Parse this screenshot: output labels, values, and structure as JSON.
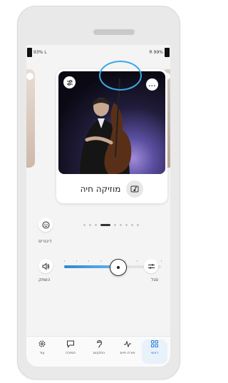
{
  "status_bar": {
    "left_text": "93% L",
    "right_text": "R 99%"
  },
  "program_card": {
    "title": "מוזיקה חיה",
    "icons": {
      "settings": "tune-icon",
      "more": "more-dots-icon",
      "program": "music-note-icon"
    },
    "more_button_label": "..."
  },
  "carousel": {
    "active_index": 3,
    "total": 9
  },
  "controls": {
    "focus_label": "דיבורים",
    "mute_label": "השתק",
    "adjust_label": "סגל",
    "volume_value": 0.55
  },
  "bottom_nav": [
    {
      "label": "עוד",
      "icon": "gear-icon",
      "active": false
    },
    {
      "label": "תמיכה",
      "icon": "chat-icon",
      "active": false
    },
    {
      "label": "התקנים",
      "icon": "ear-icon",
      "active": false
    },
    {
      "label": "אורח חיים",
      "icon": "pulse-icon",
      "active": false
    },
    {
      "label": "ראשי",
      "icon": "grid-icon",
      "active": true
    }
  ],
  "colors": {
    "accent": "#2c7cd8",
    "highlight_ring": "#3aa8e8"
  }
}
